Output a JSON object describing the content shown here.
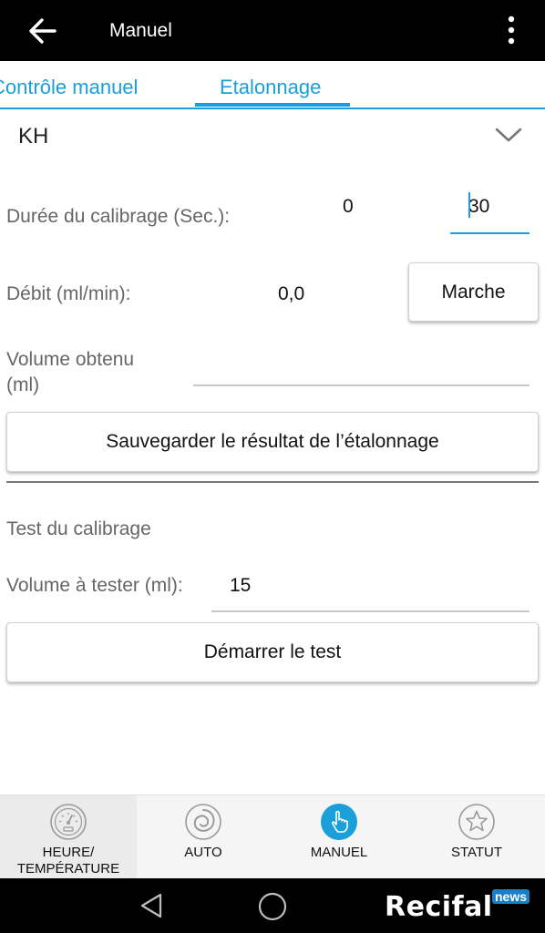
{
  "appbar": {
    "title": "Manuel"
  },
  "tabs": [
    {
      "label": "Contrôle manuel",
      "active": false
    },
    {
      "label": "Etalonnage",
      "active": true
    }
  ],
  "spinner": {
    "selected": "KH"
  },
  "form": {
    "duration_label": "Durée du calibrage (Sec.):",
    "duration_min": "0",
    "duration_value": "30",
    "flow_label": "Débit (ml/min):",
    "flow_value": "0,0",
    "run_button": "Marche",
    "volume_label_line1": "Volume obtenu",
    "volume_label_line2": "(ml)",
    "volume_value": "",
    "save_button": "Sauvegarder le résultat de l’étalonnage",
    "test_heading": "Test du calibrage",
    "test_volume_label": "Volume à tester (ml):",
    "test_volume_value": "15",
    "start_test_button": "Démarrer le test"
  },
  "bottom_nav": [
    {
      "label_line1": "HEURE/",
      "label_line2": "TEMPÉRATURE",
      "icon": "gauge-icon",
      "active": false
    },
    {
      "label_line1": "AUTO",
      "label_line2": "",
      "icon": "spiral-icon",
      "active": false
    },
    {
      "label_line1": "MANUEL",
      "label_line2": "",
      "icon": "hand-pointer-icon",
      "active": true
    },
    {
      "label_line1": "STATUT",
      "label_line2": "",
      "icon": "star-icon",
      "active": false
    }
  ],
  "watermark": {
    "brand": "Recifal",
    "badge": "news"
  },
  "colors": {
    "accent": "#1a9fd9",
    "appbar": "#000000",
    "nav_active": "#1a9fd9"
  }
}
